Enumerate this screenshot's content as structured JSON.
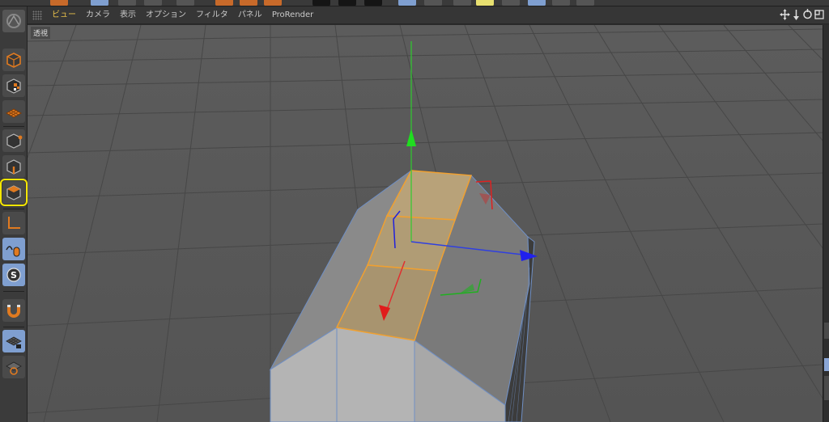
{
  "menu": {
    "items": [
      "ビュー",
      "カメラ",
      "表示",
      "オプション",
      "フィルタ",
      "パネル",
      "ProRender"
    ],
    "active_index": 0
  },
  "viewport": {
    "label": "透視"
  },
  "view_controls": [
    "move-view-icon",
    "dolly-icon",
    "rotate-view-icon",
    "maximize-icon"
  ],
  "left_palette": [
    {
      "name": "model-mode-icon",
      "selected": false
    },
    {
      "name": "texture-mode-icon",
      "selected": false
    },
    {
      "name": "workplane-mode-icon",
      "selected": false
    },
    {
      "name": "point-mode-icon",
      "selected": false
    },
    {
      "name": "edge-mode-icon",
      "selected": false
    },
    {
      "name": "polygon-mode-icon",
      "selected": true
    },
    {
      "name": "axis-mode-icon",
      "selected": false
    },
    {
      "name": "tweak-mode-icon",
      "selected": false
    },
    {
      "name": "solo-mode-icon",
      "selected": false
    },
    {
      "name": "snap-icon",
      "selected": false
    },
    {
      "name": "workplane-lock-icon",
      "selected": false
    },
    {
      "name": "workplane-align-icon",
      "selected": false
    }
  ],
  "colors": {
    "accent_selection": "#f5e600",
    "menu_active": "#e8c04a",
    "axis_x": "#e02020",
    "axis_y": "#20d020",
    "axis_z": "#2020e0",
    "selection_face": "#c8a870",
    "edge_highlight": "#f0a030"
  }
}
